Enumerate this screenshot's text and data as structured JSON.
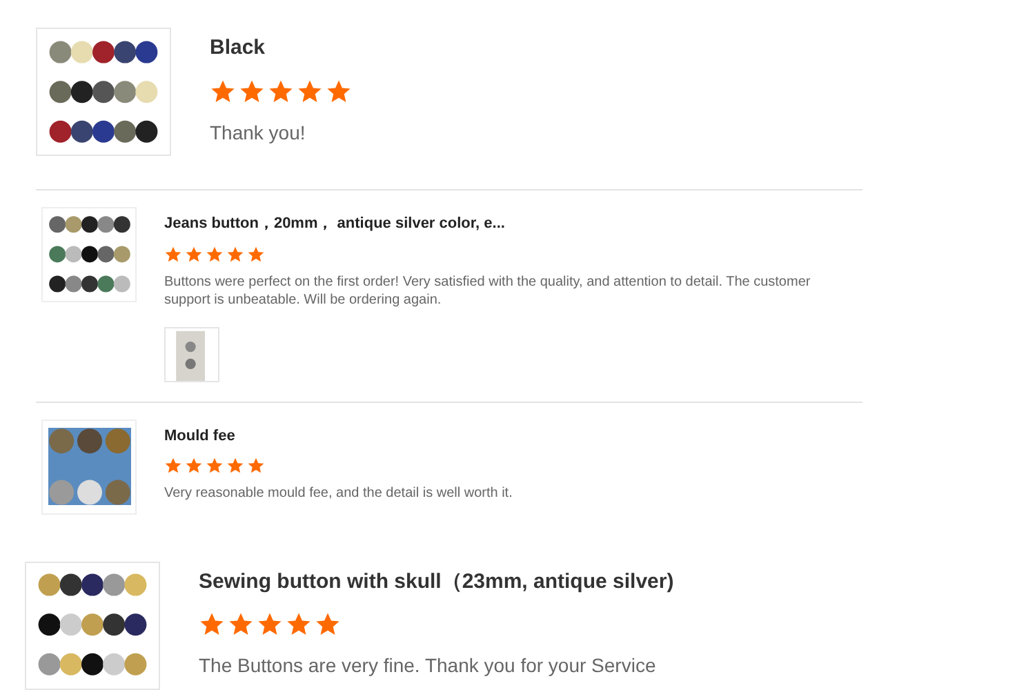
{
  "reviews": [
    {
      "kind": "large",
      "title": "Black",
      "stars": 5,
      "text": "Thank you!",
      "divider": true
    },
    {
      "kind": "compact",
      "title": "Jeans button，20mm，  antique silver color, e...",
      "stars": 5,
      "text": "Buttons were perfect on the first order! Very satisfied with the quality, and attention to detail. The customer support is unbeatable. Will be ordering again.",
      "attachments": [
        {
          "kind": "picture"
        }
      ],
      "divider": true
    },
    {
      "kind": "compact",
      "title": "Mould fee",
      "stars": 5,
      "text": "Very reasonable mould fee, and the detail is well worth it.",
      "divider": false
    },
    {
      "kind": "large",
      "title": "Sewing button with skull（23mm, antique silver)",
      "stars": 5,
      "text": "The Buttons are very fine. Thank you for your Service",
      "divider": false
    }
  ]
}
